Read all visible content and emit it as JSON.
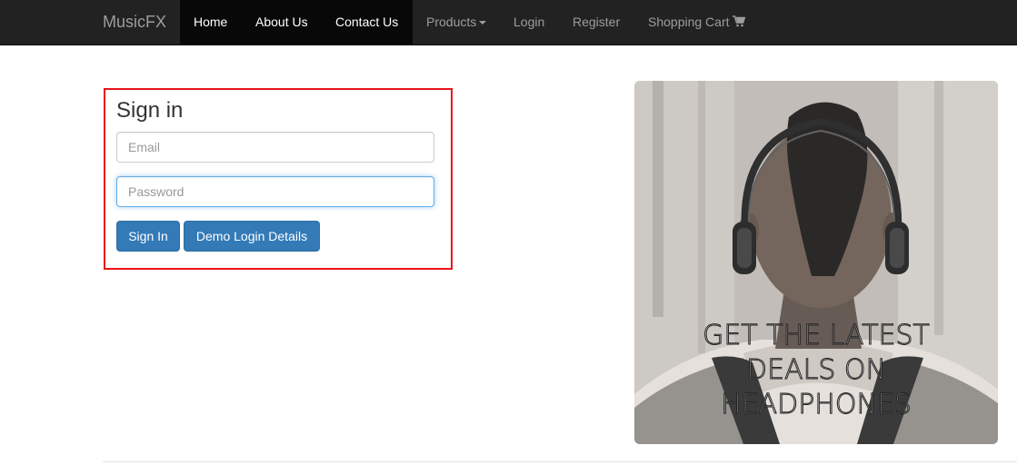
{
  "navbar": {
    "brand": "MusicFX",
    "items": [
      {
        "label": "Home"
      },
      {
        "label": "About Us"
      },
      {
        "label": "Contact Us"
      },
      {
        "label": "Products"
      },
      {
        "label": "Login"
      },
      {
        "label": "Register"
      },
      {
        "label": "Shopping Cart"
      }
    ],
    "icons": {
      "products_dropdown": "caret-down-icon",
      "cart": "shopping-cart-icon"
    }
  },
  "signin": {
    "title": "Sign in",
    "email": {
      "value": "",
      "placeholder": "Email"
    },
    "password": {
      "value": "",
      "placeholder": "Password"
    },
    "signin_button": "Sign In",
    "demo_button": "Demo Login Details",
    "highlight_color": "#e8141a"
  },
  "promo": {
    "lines": [
      "GET THE LATEST",
      "DEALS ON",
      "HEADPHONES"
    ]
  },
  "colors": {
    "navbar_bg": "#222222",
    "primary_button": "#337ab7"
  }
}
